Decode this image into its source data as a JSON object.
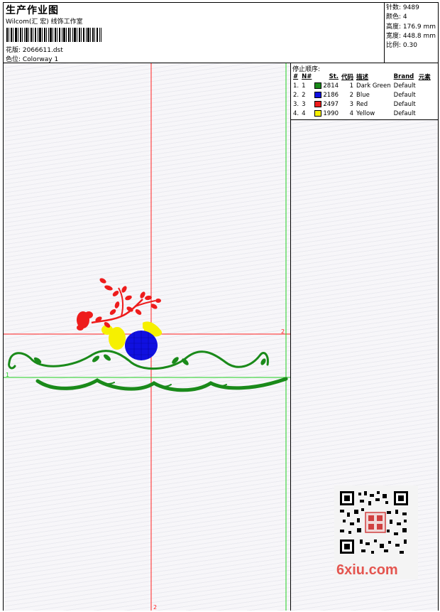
{
  "header": {
    "title": "生产作业图",
    "subtitle": "Wilcom(汇 宏) 线饰工作室",
    "design": "花版:  2066611.dst",
    "colorway": "色位:  Colorway 1"
  },
  "stats": {
    "stitches": "针数:  9489",
    "colors": "颜色:  4",
    "height": "高度:  176.9 mm",
    "width": "宽度:  448.8 mm",
    "scale": "比例:  0.30"
  },
  "stop_sequence": {
    "title": "停止顺序:",
    "columns": [
      "#",
      "N#",
      "St.",
      "代码",
      "描述",
      "Brand",
      "元素"
    ],
    "rows": [
      {
        "num": "1.",
        "n": "1",
        "st": "2814",
        "code": "1",
        "desc": "Dark Green",
        "brand": "Default",
        "color": "#1a8a1a"
      },
      {
        "num": "2.",
        "n": "2",
        "st": "2186",
        "code": "2",
        "desc": "Blue",
        "brand": "Default",
        "color": "#1010e0"
      },
      {
        "num": "3.",
        "n": "3",
        "st": "2497",
        "code": "3",
        "desc": "Red",
        "brand": "Default",
        "color": "#ee1c1c"
      },
      {
        "num": "4.",
        "n": "4",
        "st": "1990",
        "code": "4",
        "desc": "Yellow",
        "brand": "Default",
        "color": "#f6f000"
      }
    ]
  },
  "guides": {
    "red_h_label": "2",
    "red_v_label": "2",
    "green_h_label": "1"
  },
  "colors": {
    "red_guide": "#ff2020",
    "green_guide": "#20d020",
    "dark_green": "#1a8a1a",
    "blue": "#1010e0",
    "red": "#ee1c1c",
    "yellow": "#f6f000"
  },
  "watermark": {
    "text": "6xiu.com"
  }
}
